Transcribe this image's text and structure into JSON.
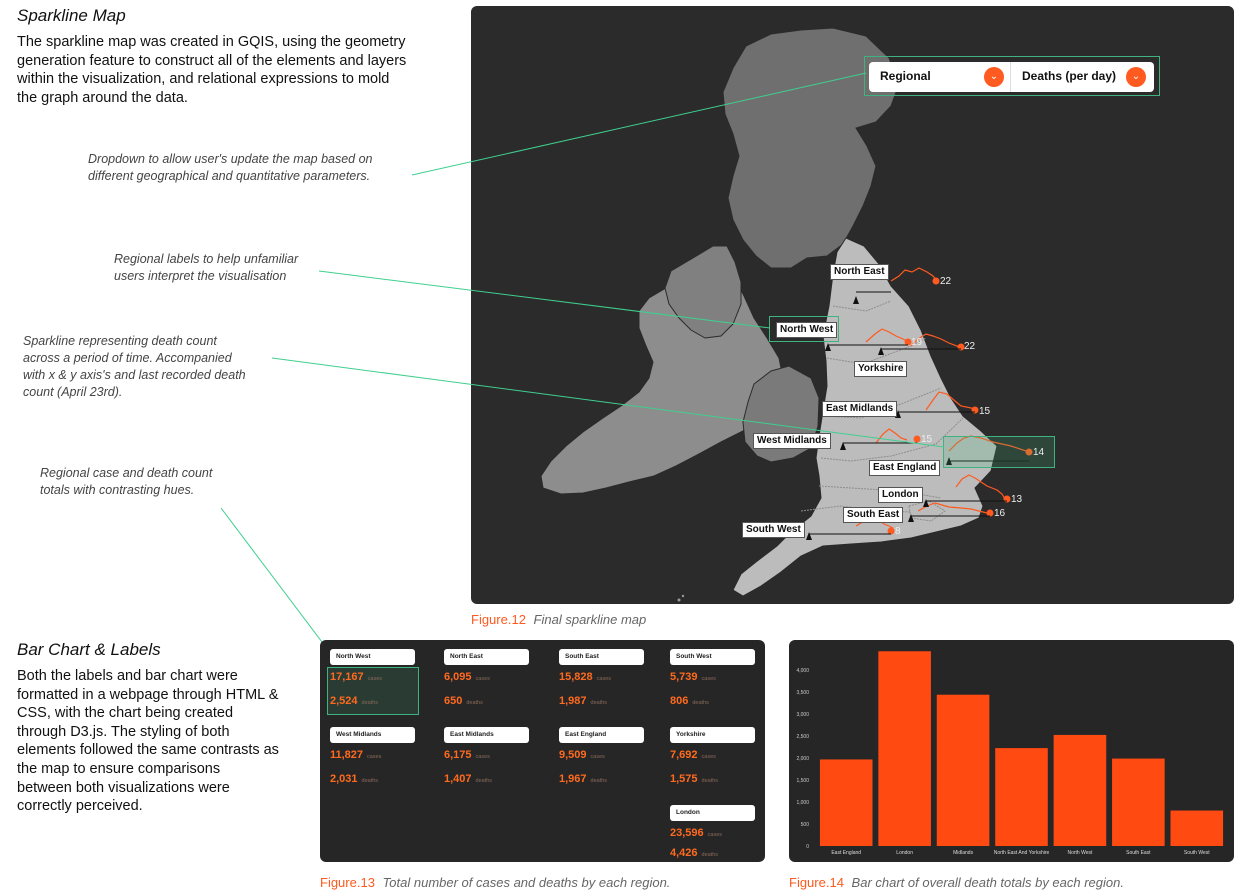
{
  "sparkline_section": {
    "title": "Sparkline Map",
    "paragraph_lines": [
      "The sparkline map was created in GQIS, using the geometry",
      "generation feature to construct all of the elements and layers",
      "within the visualization, and relational expressions to mold",
      "the graph around the data."
    ]
  },
  "annotations": {
    "dropdown_lines": [
      "Dropdown to allow user's update the map based on",
      "different geographical and quantitative parameters."
    ],
    "labels_lines": [
      "Regional labels to help unfamiliar",
      "users interpret the visualisation"
    ],
    "sparkline_lines": [
      "Sparkline representing death count",
      "across a period of time. Accompanied",
      "with x & y axis's and last recorded death",
      "count (April 23rd)."
    ],
    "totals_lines": [
      "Regional case and death count",
      "totals with contrasting hues."
    ]
  },
  "map": {
    "dropdown_region": "Regional",
    "dropdown_metric": "Deaths (per day)",
    "labels": [
      "North East",
      "North West",
      "Yorkshire",
      "East Midlands",
      "West Midlands",
      "East England",
      "London",
      "South East",
      "South West"
    ],
    "end_values": [
      "22",
      "19",
      "22",
      "15",
      "15",
      "14",
      "13",
      "16",
      "8"
    ]
  },
  "captions": {
    "fig12_num": "Figure.12",
    "fig12_text": "Final sparkline map",
    "fig13_num": "Figure.13",
    "fig13_text": "Total number of cases and deaths by each region.",
    "fig14_num": "Figure.14",
    "fig14_text": "Bar chart of overall death totals by each region."
  },
  "bar_section": {
    "title": "Bar Chart & Labels",
    "paragraph_lines": [
      "Both the labels and bar chart were",
      "formatted in a webpage through HTML &",
      "CSS, with the chart being created",
      "through D3.js. The styling of both",
      "elements followed the same contrasts as",
      "the map to ensure comparisons",
      "between both visualizations were",
      "correctly perceived."
    ]
  },
  "cards": {
    "cases_unit": "cases",
    "deaths_unit": "deaths",
    "items": [
      {
        "name": "North West",
        "cases": "17,167",
        "deaths": "2,524"
      },
      {
        "name": "North East",
        "cases": "6,095",
        "deaths": "650"
      },
      {
        "name": "South East",
        "cases": "15,828",
        "deaths": "1,987"
      },
      {
        "name": "South West",
        "cases": "5,739",
        "deaths": "806"
      },
      {
        "name": "West Midlands",
        "cases": "11,827",
        "deaths": "2,031"
      },
      {
        "name": "East Midlands",
        "cases": "6,175",
        "deaths": "1,407"
      },
      {
        "name": "East England",
        "cases": "9,509",
        "deaths": "1,967"
      },
      {
        "name": "Yorkshire",
        "cases": "7,692",
        "deaths": "1,575"
      },
      {
        "name": "London",
        "cases": "23,596",
        "deaths": "4,426"
      }
    ]
  },
  "chart_data": {
    "type": "bar",
    "title": "",
    "xlabel": "",
    "ylabel": "",
    "categories": [
      "East England",
      "London",
      "Midlands",
      "North East And Yorkshire",
      "North West",
      "South East",
      "South West"
    ],
    "values": [
      1967,
      4426,
      3438,
      2225,
      2524,
      1987,
      806
    ],
    "ylim": [
      0,
      4500
    ],
    "yticks": [
      "0",
      "500",
      "1,000",
      "1,500",
      "2,000",
      "2,500",
      "3,000",
      "3,500",
      "4,000"
    ],
    "bar_color": "#ff4a12",
    "grid": false
  },
  "colors": {
    "accent": "#ff5a1f",
    "highlight": "#3fb37f",
    "panel": "#2b2b2b"
  }
}
